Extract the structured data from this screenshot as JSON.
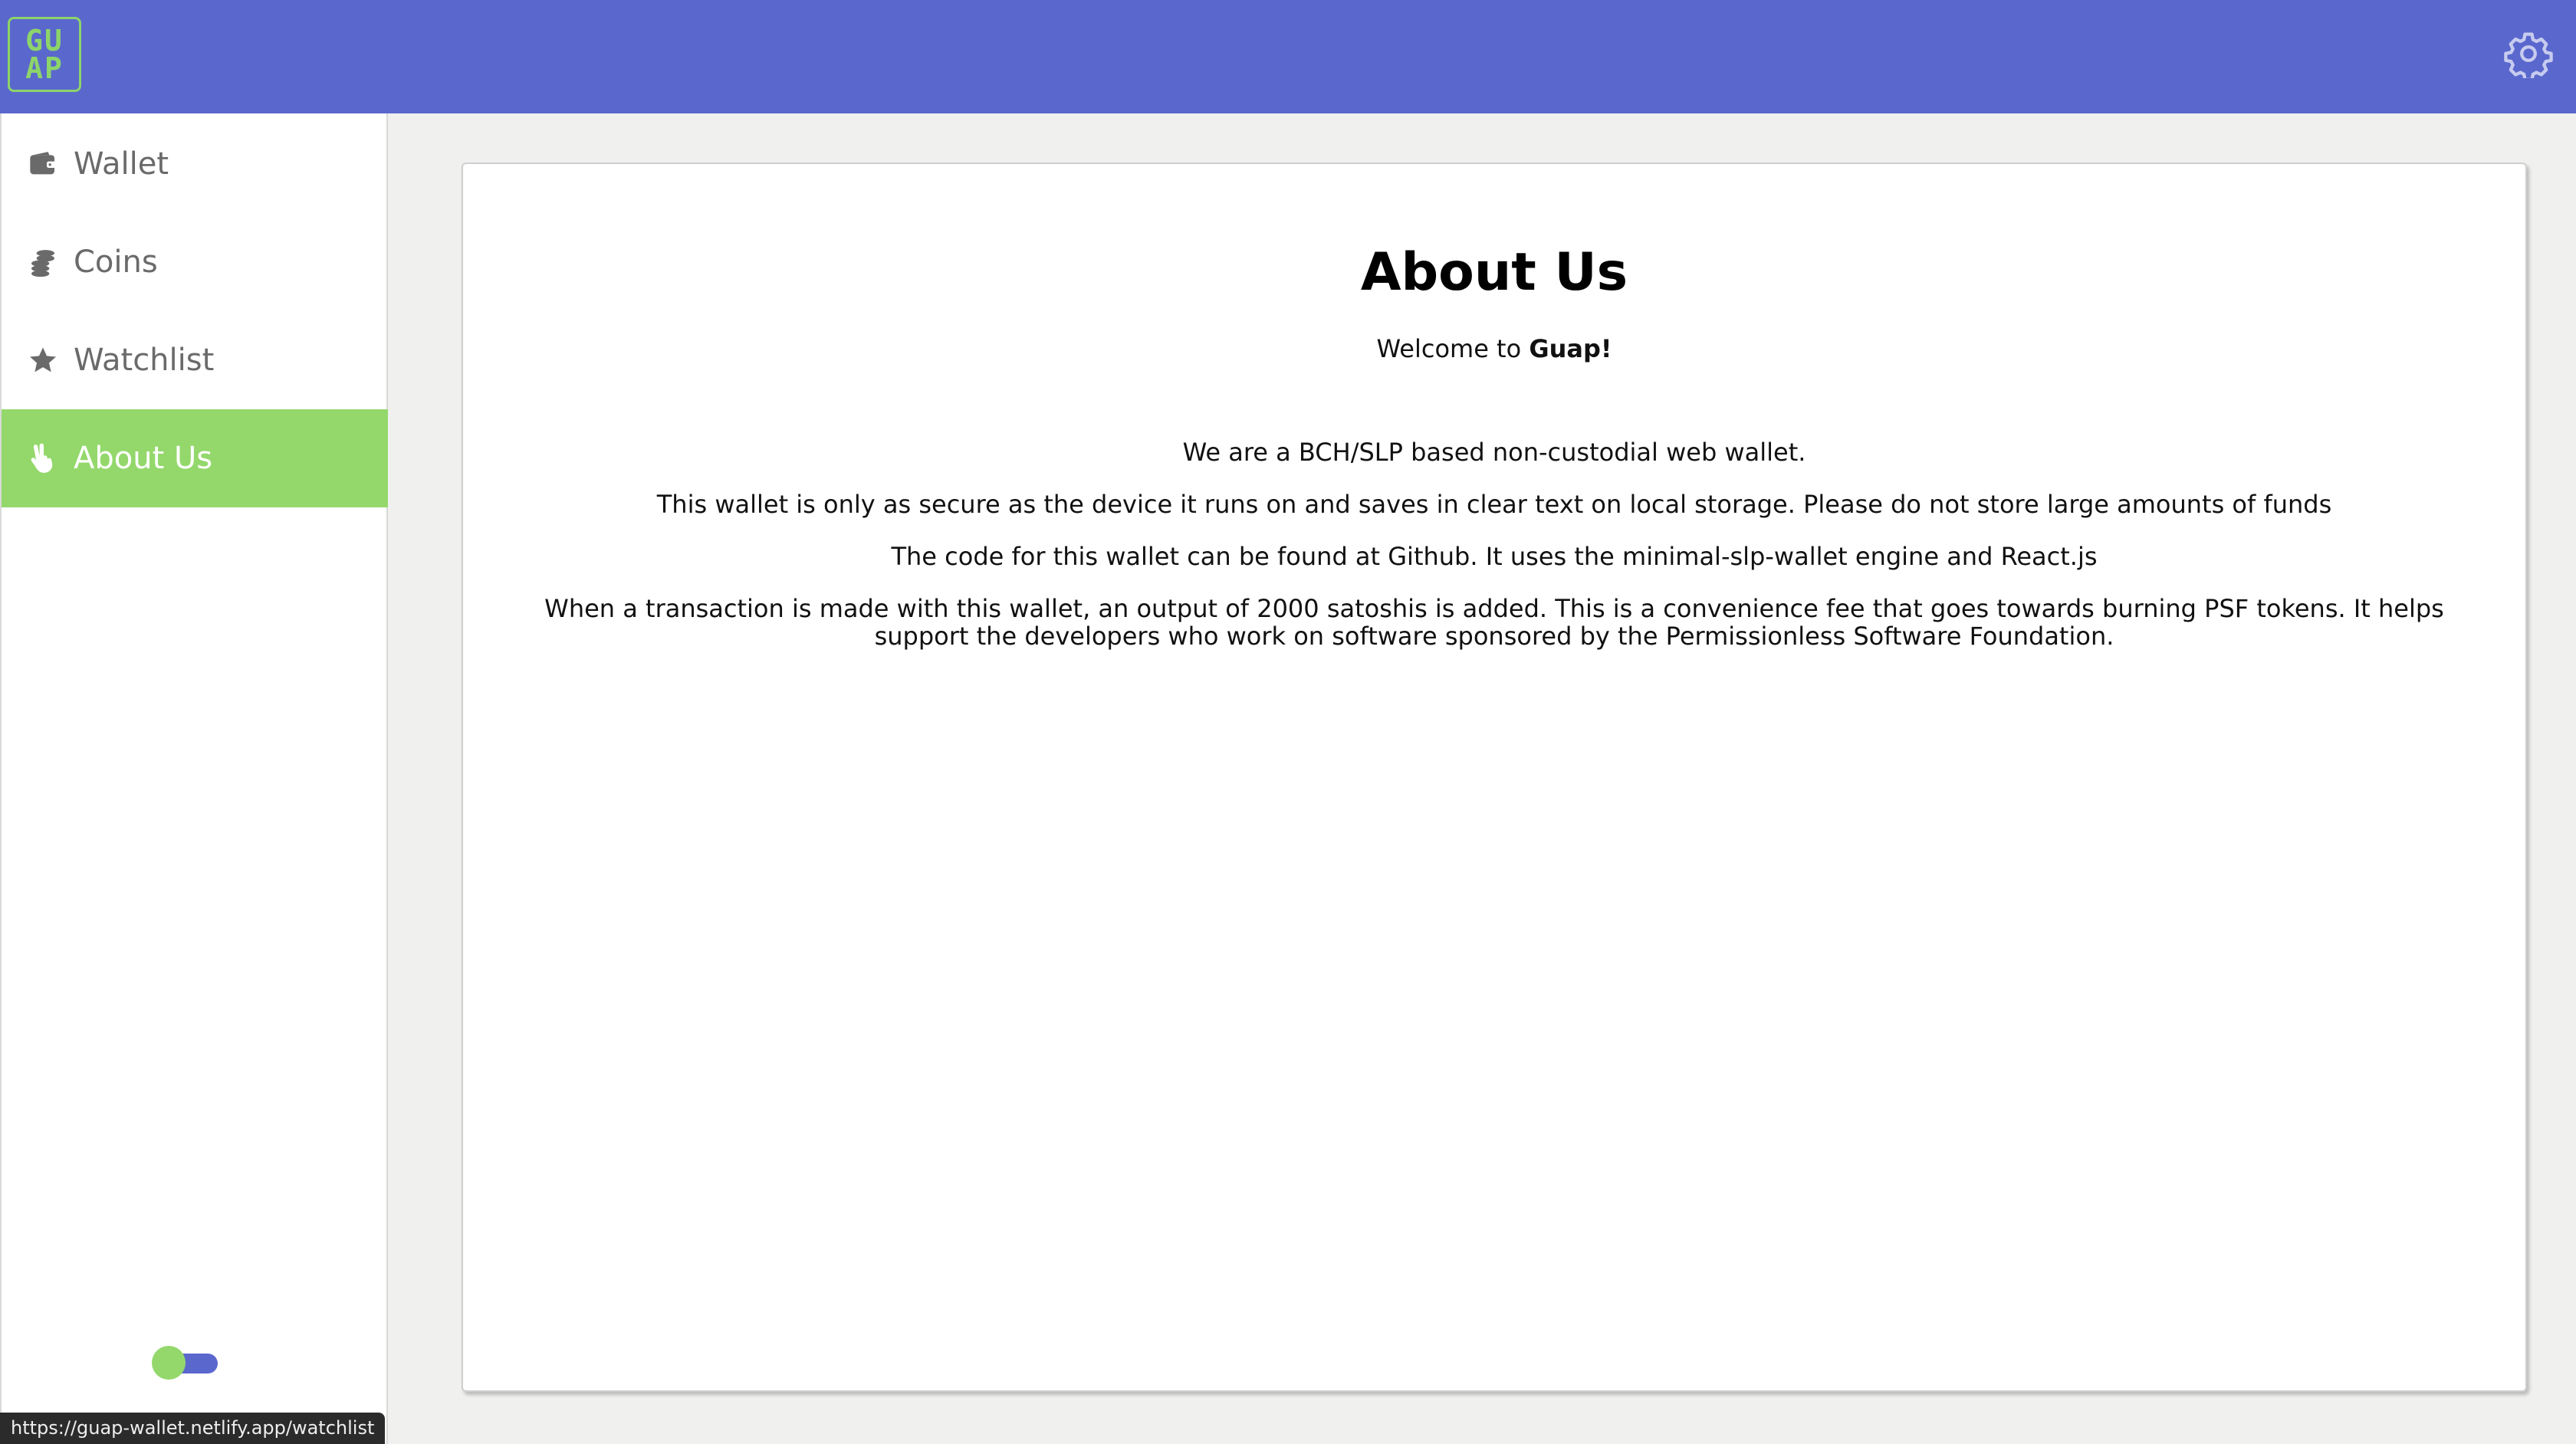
{
  "header": {
    "logo_text": "GU\nAP",
    "settings_icon": "gear-icon"
  },
  "sidebar": {
    "items": [
      {
        "label": "Wallet",
        "icon": "wallet-icon",
        "active": false
      },
      {
        "label": "Coins",
        "icon": "coins-icon",
        "active": false
      },
      {
        "label": "Watchlist",
        "icon": "star-icon",
        "active": false
      },
      {
        "label": "About Us",
        "icon": "peace-hand-icon",
        "active": true
      }
    ],
    "theme_toggle": "toggle-switch"
  },
  "status_bar": {
    "url": "https://guap-wallet.netlify.app/watchlist"
  },
  "main": {
    "title": "About Us",
    "welcome_prefix": "Welcome to ",
    "welcome_brand": "Guap!",
    "paragraphs": [
      "We are a BCH/SLP based non-custodial web wallet.",
      "This wallet is only as secure as the device it runs on and saves in clear text on local storage. Please do not store large amounts of funds",
      "The code for this wallet can be found at Github. It uses the minimal-slp-wallet engine and React.js",
      "When a transaction is made with this wallet, an output of 2000 satoshis is added. This is a convenience fee that goes towards burning PSF tokens. It helps support the developers who work on software sponsored by the Permissionless Software Foundation."
    ]
  },
  "colors": {
    "header": "#5a67cd",
    "accent_green": "#94d86c",
    "background": "#f0f0ee"
  }
}
